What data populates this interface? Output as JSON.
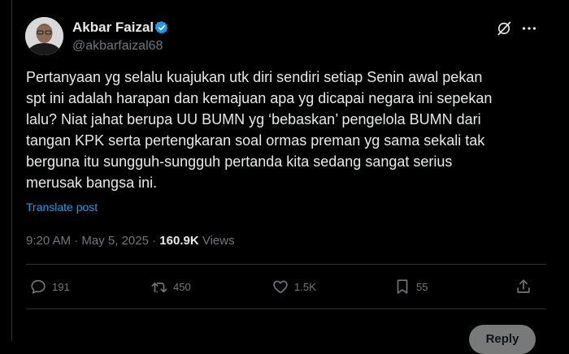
{
  "author": {
    "display_name": "Akbar Faizal",
    "handle": "@akbarfaizal68",
    "verified": true
  },
  "post": {
    "text": "Pertanyaan yg selalu kuajukan utk diri sendiri setiap Senin awal pekan\nspt ini adalah harapan dan kemajuan apa yg dicapai negara ini sepekan\nlalu? Niat jahat berupa UU BUMN yg ‘bebaskan’ pengelola BUMN dari\ntangan KPK serta pertengkaran soal ormas preman yg sama sekali tak\nberguna itu sungguh-sungguh pertanda kita sedang sangat serius\nmerusak bangsa ini.",
    "translate_label": "Translate post",
    "time": "9:20 AM",
    "separator": "·",
    "date": "May 5, 2025",
    "views_count": "160.9K",
    "views_label": "Views"
  },
  "actions": {
    "replies": "191",
    "reposts": "450",
    "likes": "1.5K",
    "bookmarks": "55"
  },
  "reply_button": "Reply",
  "colors": {
    "background": "#000000",
    "text": "#e7e9ea",
    "muted": "#71767b",
    "link": "#1d9bf0",
    "verified": "#1d9bf0"
  },
  "icons": [
    "verified-badge-icon",
    "grok-icon",
    "more-icon",
    "reply-icon",
    "repost-icon",
    "like-icon",
    "bookmark-icon",
    "share-icon"
  ]
}
